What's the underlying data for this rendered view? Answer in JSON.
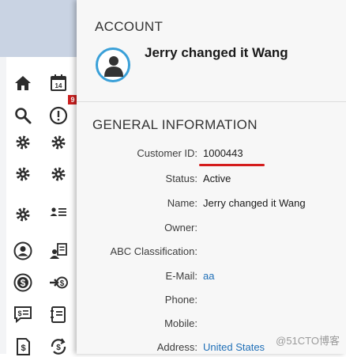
{
  "nav": {
    "notification_count": "9",
    "calendar_day": "14"
  },
  "account": {
    "section_title": "ACCOUNT",
    "name": "Jerry changed it Wang"
  },
  "general": {
    "section_title": "GENERAL INFORMATION",
    "fields": [
      {
        "label": "Customer ID:",
        "value": "1000443"
      },
      {
        "label": "Status:",
        "value": "Active"
      },
      {
        "label": "Name:",
        "value": "Jerry changed it Wang"
      },
      {
        "label": "Owner:",
        "value": ""
      },
      {
        "label": "ABC Classification:",
        "value": ""
      },
      {
        "label": "E-Mail:",
        "value": "aa"
      },
      {
        "label": "Phone:",
        "value": ""
      },
      {
        "label": "Mobile:",
        "value": ""
      },
      {
        "label": "Address:",
        "value": "United States"
      }
    ]
  },
  "watermark": "@51CTO博客",
  "colors": {
    "accent": "#3aa0d8",
    "link": "#1f6fb7",
    "highlight_underline": "#d41c1c",
    "badge": "#cc1f1f"
  }
}
